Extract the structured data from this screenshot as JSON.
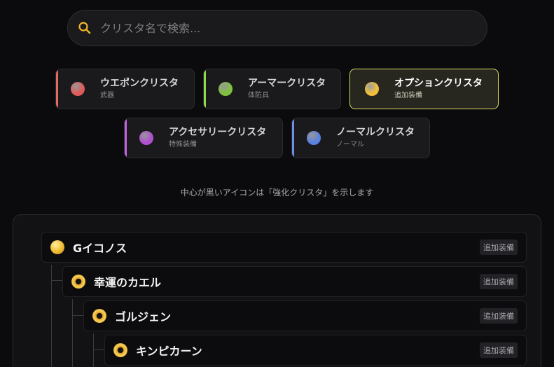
{
  "search": {
    "placeholder": "クリスタ名で検索..."
  },
  "categories": [
    {
      "name": "ウエポンクリスタ",
      "sub": "武器",
      "color": "#e15a5a",
      "accent": "#e46a6a"
    },
    {
      "name": "アーマークリスタ",
      "sub": "体防具",
      "color": "#7fc23c",
      "accent": "#8ddc4a"
    },
    {
      "name": "オプションクリスタ",
      "sub": "追加装備",
      "color": "#f2bf3c",
      "accent": "#d8df63",
      "active": true
    },
    {
      "name": "アクセサリークリスタ",
      "sub": "特殊装備",
      "color": "#b04fd0",
      "accent": "#c561e0"
    },
    {
      "name": "ノーマルクリスタ",
      "sub": "ノーマル",
      "color": "#5b82e0",
      "accent": "#6d8fe6"
    }
  ],
  "note": "中心が黒いアイコンは「強化クリスタ」を示します",
  "tree": [
    {
      "name": "Gイコノス",
      "tag": "追加装備",
      "enhanced": false
    },
    {
      "name": "幸運のカエル",
      "tag": "追加装備",
      "enhanced": true
    },
    {
      "name": "ゴルジェン",
      "tag": "追加装備",
      "enhanced": true
    },
    {
      "name": "キンピカーン",
      "tag": "追加装備",
      "enhanced": true
    }
  ]
}
